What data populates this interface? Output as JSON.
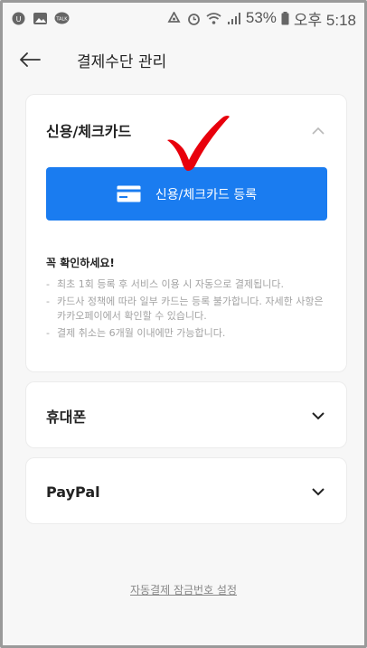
{
  "status_bar": {
    "battery": "53%",
    "time": "오후 5:18",
    "icons": [
      "kakaotalk-icon",
      "image-icon",
      "talk-icon",
      "recycle-icon",
      "alarm-icon",
      "wifi-icon",
      "signal-icon",
      "battery-icon"
    ]
  },
  "header": {
    "title": "결제수단 관리",
    "back_icon": "back-arrow-icon"
  },
  "cards": {
    "credit": {
      "title": "신용/체크카드",
      "expanded": true,
      "register_label": "신용/체크카드 등록",
      "notice_title": "꼭 확인하세요!",
      "notices": [
        "최초 1회 등록 후 서비스 이용 시 자동으로 결제됩니다.",
        "카드사 정책에 따라 일부 카드는 등록 불가합니다. 자세한 사항은 카카오페이에서 확인할 수 있습니다.",
        "결제 취소는 6개월 이내에만 가능합니다."
      ]
    },
    "phone": {
      "title": "휴대폰",
      "expanded": false
    },
    "paypal": {
      "title": "PayPal",
      "expanded": false
    }
  },
  "footer": {
    "link": "자동결제 잠금번호 설정"
  },
  "colors": {
    "accent": "#1a7cf0",
    "annotation": "#e8000c",
    "background": "#f7f7f7"
  }
}
